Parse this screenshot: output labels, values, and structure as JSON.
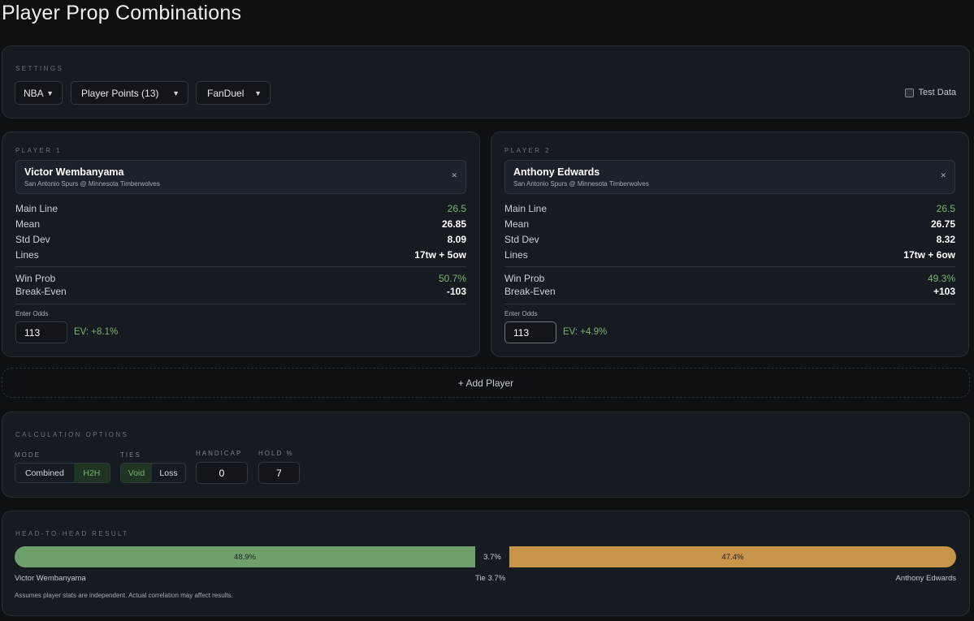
{
  "title": "Player Prop Combinations",
  "settings": {
    "label": "SETTINGS",
    "league": "NBA",
    "market": "Player Points (13)",
    "book": "FanDuel",
    "test_data_label": "Test Data",
    "test_data_checked": false
  },
  "players": [
    {
      "section_label": "PLAYER 1",
      "name": "Victor Wembanyama",
      "game": "San Antonio Spurs @ Minnesota Timberwolves",
      "stats": {
        "main_line_label": "Main Line",
        "main_line": "26.5",
        "mean_label": "Mean",
        "mean": "26.85",
        "std_label": "Std Dev",
        "std": "8.09",
        "lines_label": "Lines",
        "lines": "17tw + 5ow",
        "win_prob_label": "Win Prob",
        "win_prob": "50.7%",
        "break_even_label": "Break-Even",
        "break_even": "-103"
      },
      "odds_label": "Enter Odds",
      "odds": "113",
      "ev": "EV: +8.1%"
    },
    {
      "section_label": "PLAYER 2",
      "name": "Anthony Edwards",
      "game": "San Antonio Spurs @ Minnesota Timberwolves",
      "stats": {
        "main_line_label": "Main Line",
        "main_line": "26.5",
        "mean_label": "Mean",
        "mean": "26.75",
        "std_label": "Std Dev",
        "std": "8.32",
        "lines_label": "Lines",
        "lines": "17tw + 6ow",
        "win_prob_label": "Win Prob",
        "win_prob": "49.3%",
        "break_even_label": "Break-Even",
        "break_even": "+103"
      },
      "odds_label": "Enter Odds",
      "odds": "113",
      "ev": "EV: +4.9%"
    }
  ],
  "add_player_label": "+ Add Player",
  "calc": {
    "label": "CALCULATION OPTIONS",
    "mode_label": "MODE",
    "mode_options": [
      "Combined",
      "H2H"
    ],
    "mode_selected": "H2H",
    "ties_label": "TIES",
    "ties_options": [
      "Void",
      "Loss"
    ],
    "ties_selected": "Void",
    "handicap_label": "HANDICAP",
    "handicap": "0",
    "hold_label": "HOLD %",
    "hold": "7"
  },
  "result": {
    "label": "HEAD-TO-HEAD RESULT",
    "p1_pct": "48.9%",
    "tie_pct": "3.7%",
    "p2_pct": "47.4%",
    "p1_name": "Victor Wembanyama",
    "tie_label": "Tie 3.7%",
    "p2_name": "Anthony Edwards",
    "note": "Assumes player stats are independent. Actual correlation may affect results.",
    "colors": {
      "p1": "#6fa06b",
      "p2": "#c7944a"
    }
  }
}
